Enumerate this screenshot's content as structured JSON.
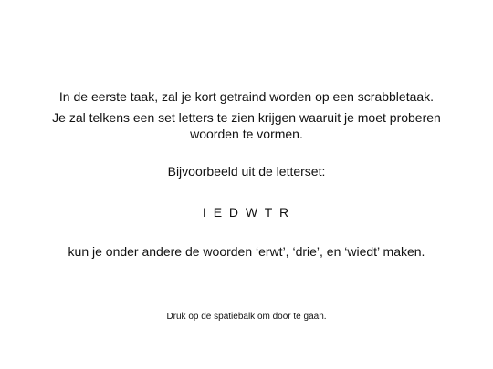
{
  "slide": {
    "intro_line_1": "In de eerste taak, zal je kort getraind worden op een scrabbletaak.",
    "intro_line_2": "Je zal telkens een set letters te zien krijgen waaruit je moet proberen",
    "intro_line_3": "woorden te vormen.",
    "example_heading": "Bijvoorbeeld uit de letterset:",
    "letter_set": "I E D W T R",
    "example_words": "kun je onder andere de woorden ‘erwt’, ‘drie’, en ‘wiedt’ maken.",
    "continue_hint": "Druk op de spatiebalk om door te gaan."
  }
}
